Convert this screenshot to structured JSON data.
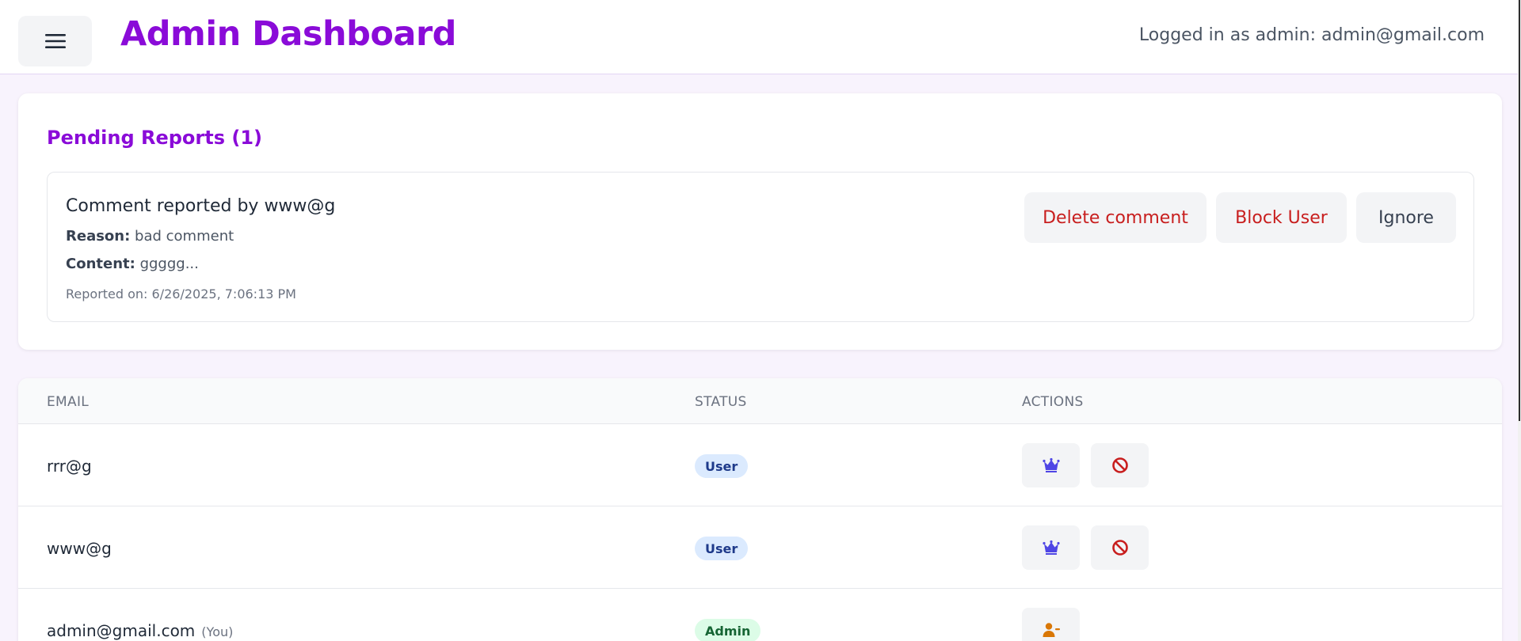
{
  "header": {
    "title": "Admin Dashboard",
    "logged_in_text": "Logged in as admin: admin@gmail.com",
    "menu_icon": "hamburger-menu-icon"
  },
  "reports": {
    "title": "Pending Reports (1)",
    "items": [
      {
        "heading": "Comment reported by www@g",
        "reason_label": "Reason:",
        "reason": "bad comment",
        "content_label": "Content:",
        "content": "ggggg...",
        "reported_on": "Reported on: 6/26/2025, 7:06:13 PM",
        "delete_label": "Delete comment",
        "block_label": "Block User",
        "ignore_label": "Ignore"
      }
    ]
  },
  "users_table": {
    "columns": [
      "EMAIL",
      "STATUS",
      "ACTIONS"
    ],
    "rows": [
      {
        "email": "rrr@g",
        "you": "",
        "status": "User",
        "actions": [
          "crown-icon",
          "ban-icon"
        ]
      },
      {
        "email": "www@g",
        "you": "",
        "status": "User",
        "actions": [
          "crown-icon",
          "ban-icon"
        ]
      },
      {
        "email": "admin@gmail.com",
        "you": "(You)",
        "status": "Admin",
        "actions": [
          "user-minus-icon"
        ]
      }
    ]
  },
  "colors": {
    "brand": "#8a0bd8",
    "danger": "#c81e1e",
    "crown": "#4f46e5",
    "demote": "#d97706",
    "page_bg": "#f8f3fd"
  }
}
